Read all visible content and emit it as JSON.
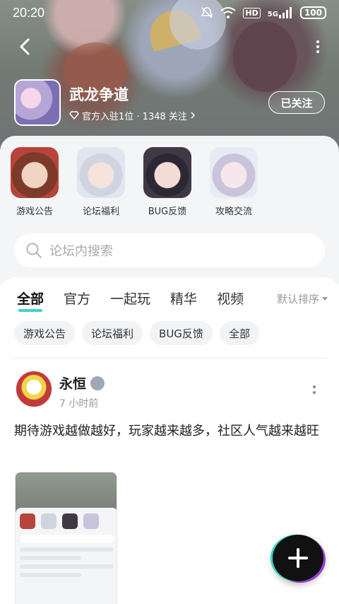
{
  "status_bar": {
    "time": "20:20",
    "battery": "100",
    "net_label": "HD",
    "signal_label": "5G"
  },
  "header": {
    "forum_name": "武龙争道",
    "meta": "官方入驻1位 · 1348 关注",
    "follow_label": "已关注"
  },
  "categories": [
    {
      "label": "游戏公告"
    },
    {
      "label": "论坛福利"
    },
    {
      "label": "BUG反馈"
    },
    {
      "label": "攻略交流"
    }
  ],
  "search": {
    "placeholder": "论坛内搜索"
  },
  "tabs": [
    {
      "label": "全部",
      "active": true
    },
    {
      "label": "官方"
    },
    {
      "label": "一起玩"
    },
    {
      "label": "精华"
    },
    {
      "label": "视频"
    }
  ],
  "sort_label": "默认排序",
  "chips": [
    "游戏公告",
    "论坛福利",
    "BUG反馈",
    "全部"
  ],
  "post": {
    "username": "永恒",
    "time": "7 小时前",
    "text": "期待游戏越做越好，玩家越来越多，社区人气越来越旺"
  },
  "colors": {
    "accent": "#3fd3c9",
    "fab": "#111111"
  },
  "icons": {
    "back": "back-arrow-icon",
    "more": "more-vertical-icon",
    "search": "search-icon",
    "fab": "plus-icon"
  }
}
